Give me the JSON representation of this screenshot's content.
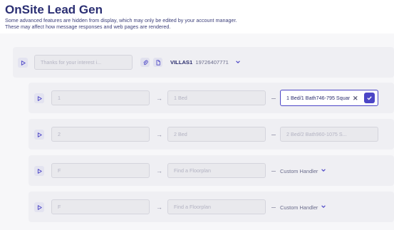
{
  "header": {
    "title": "OnSite Lead Gen",
    "notice_line1": "Some advanced features are hidden from display, which may only be edited by your account manager.",
    "notice_line2": "These may affect how message responses and web pages are rendered."
  },
  "main_row": {
    "message_placeholder": "Thanks for your interest i...",
    "keyword": "VILLAS1",
    "phone": "19726407771",
    "icons": [
      "play-icon",
      "paperclip-icon",
      "document-icon",
      "chevron-down-icon"
    ]
  },
  "rows": [
    {
      "key": "1",
      "label": "1 Bed",
      "response": "1 Bed/1 Bath746-795 Squar"
    },
    {
      "key": "2",
      "label": "2 Bed",
      "response": "2 Bed/2 Bath960-1075 S..."
    },
    {
      "key": "F",
      "label": "Find a Floorplan",
      "response": "Custom Handler"
    },
    {
      "key": "F",
      "label": "Find a Floorplan",
      "response": "Custom Handler"
    }
  ],
  "colors": {
    "accent": "#4b45c6",
    "title": "#2b2f73",
    "row_bg": "#efeff3"
  }
}
